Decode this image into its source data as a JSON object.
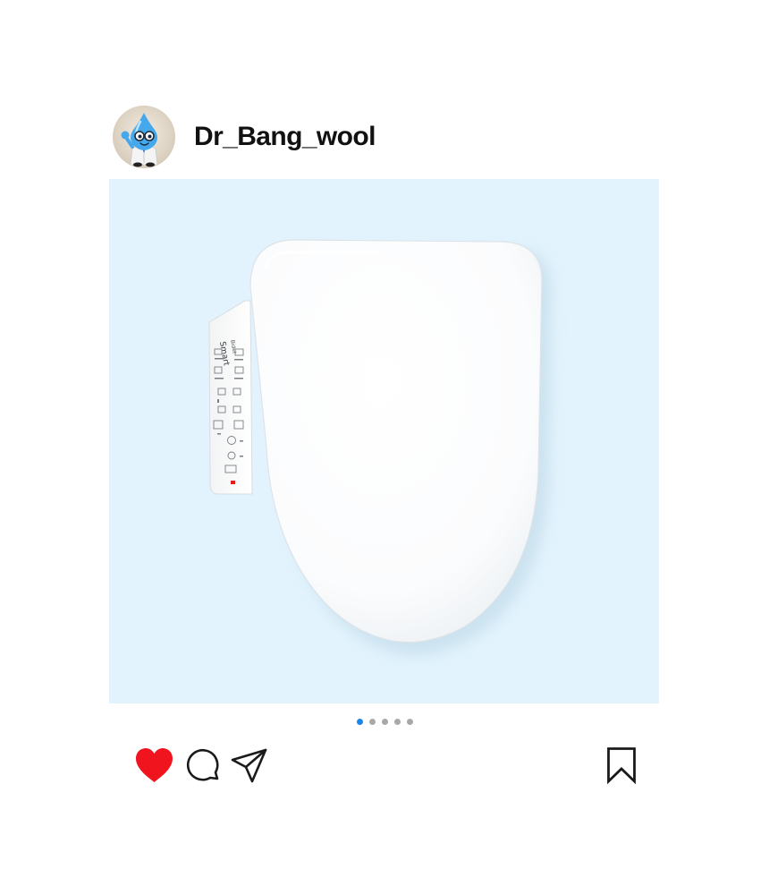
{
  "post": {
    "username": "Dr_Bang_wool",
    "avatar_icon": "water-drop-doctor-mascot",
    "image": {
      "subject": "bidet-toilet-seat",
      "panel_text": {
        "brand": "Smart",
        "sub": "Bidet"
      },
      "background": "#e2f3fd"
    },
    "carousel": {
      "current": 1,
      "total": 5
    },
    "liked": true,
    "colors": {
      "like": "#f0141e",
      "dot_active": "#1a87e6",
      "dot_inactive": "#a8a8a8"
    },
    "actions": {
      "like_icon": "heart-icon",
      "comment_icon": "comment-icon",
      "share_icon": "paper-plane-icon",
      "save_icon": "bookmark-icon"
    }
  }
}
